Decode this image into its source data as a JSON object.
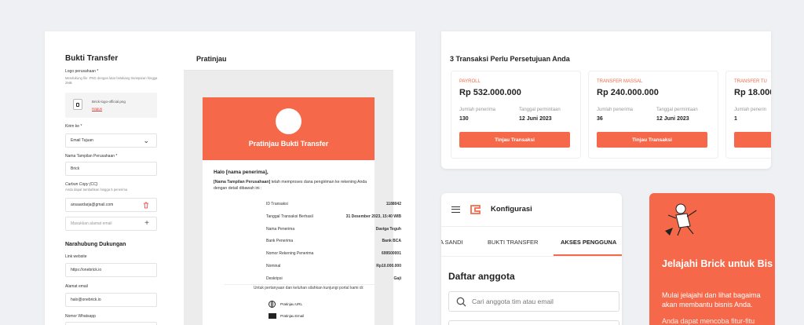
{
  "form": {
    "title": "Bukti Transfer",
    "logo_label": "Logo perusahaan *",
    "logo_hint": "Mendukung file .PNG dengan latar belakang transparan hingga 2MB",
    "logo_file": "Brick-logo-official.png",
    "logo_delete": "Hapus",
    "send_to_label": "Kirim ke *",
    "send_to_value": "Email Tujuan",
    "display_name_label": "Nama Tampilan Perusahaan *",
    "display_name_value": "Brick",
    "cc_label": "Carbon Copy (CC)",
    "cc_hint": "Anda dapat tambahkan hingga 5 penerima",
    "cc_value": "ansaardarja@gmail.com",
    "cc_placeholder": "Masukkan alamat email",
    "support_title": "Narahubung Dukungan",
    "website_label": "Link website",
    "website_value": "https://onebrick.io",
    "email_label": "Alamat email",
    "email_value": "halo@onebrick.io",
    "whatsapp_label": "Nomor Whatsapp"
  },
  "preview": {
    "title": "Pratinjau",
    "banner_title": "Pratinjau Bukti Transfer",
    "greeting": "Halo [nama penerima],",
    "intro_bold": "[Nama Tampilan Perusahaan]",
    "intro_rest": " telah memproses dana pengiriman ke rekening Anda dengan detail dibawah ini :",
    "rows": [
      {
        "k": "ID Transaksi",
        "v": "1188042"
      },
      {
        "k": "Tanggal Transaksi Berhasil",
        "v": "31 Desember 2023, 15:40 WIB"
      },
      {
        "k": "Nama Penerima",
        "v": "Daviga Teguh"
      },
      {
        "k": "Bank Penerima",
        "v": "Bank BCA"
      },
      {
        "k": "Nomor Rekening Penerima",
        "v": "699500001"
      },
      {
        "k": "Nominal",
        "v": "Rp10.000.000"
      },
      {
        "k": "Deskripsi",
        "v": "Gaji"
      }
    ],
    "footer_text": "Untuk pertanyaan dan keluhan silahkan kunjungi portal kami di:",
    "link_url": "Pratinjau URL",
    "link_email": "Pratinjau Email"
  },
  "approvals": {
    "title": "3 Transaksi Perlu Persetujuan Anda",
    "recipients_label": "Jumlah penerima",
    "date_label": "Tanggal permintaan",
    "button": "Tinjau Transaksi",
    "items": [
      {
        "type": "PAYROLL",
        "amount": "Rp 532.000.000",
        "recipients": "130",
        "date": "12 Juni 2023"
      },
      {
        "type": "TRANSFER MASSAL",
        "amount": "Rp 240.000.000",
        "recipients": "36",
        "date": "12 Juni 2023"
      },
      {
        "type": "TRANSFER TU",
        "amount": "Rp 18.000",
        "recipients": "1",
        "label_cut": "Jumlah penerin",
        "button_cut": "T"
      }
    ]
  },
  "mobile": {
    "title": "Konfigurasi",
    "tabs": [
      "A SANDI",
      "BUKTI TRANSFER",
      "AKSES PENGGUNA"
    ],
    "section": "Daftar anggota",
    "search_placeholder": "Cari anggota tim atau email"
  },
  "promo": {
    "title": "Jelajahi Brick untuk Bis Anda!",
    "line1": "Mulai jelajahi dan lihat bagaima",
    "line2": "akan membantu bisnis Anda.",
    "line3": "Anda dapat mencoba fitur-fitu"
  },
  "colors": {
    "accent": "#f5694a",
    "background": "#eef0f3"
  }
}
